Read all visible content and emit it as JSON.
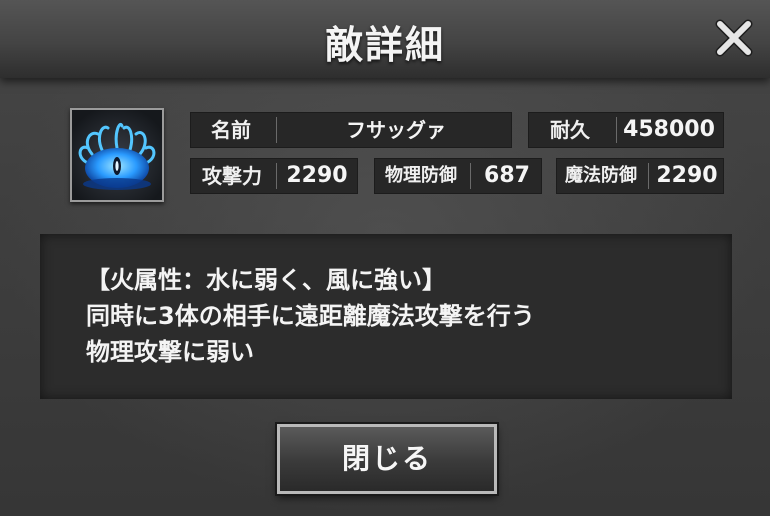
{
  "dialog": {
    "title": "敵詳細",
    "close_icon": "close-x-icon"
  },
  "enemy": {
    "portrait_icon": "water-creature-icon",
    "name_label": "名前",
    "name_value": "フサッグァ",
    "hp_label": "耐久",
    "hp_value": "458000",
    "attack_label": "攻撃力",
    "attack_value": "2290",
    "phys_def_label": "物理防御",
    "phys_def_value": "687",
    "mag_def_label": "魔法防御",
    "mag_def_value": "2290"
  },
  "description": {
    "lines": [
      "【火属性：水に弱く、風に強い】",
      "同時に3体の相手に遠距離魔法攻撃を行う",
      "物理攻撃に弱い"
    ]
  },
  "footer": {
    "close_button_label": "閉じる"
  },
  "colors": {
    "background": "#3c3c3c",
    "cell_background": "#272727",
    "text": "#f2f2f2",
    "portrait_glow": "#39a8ff"
  }
}
